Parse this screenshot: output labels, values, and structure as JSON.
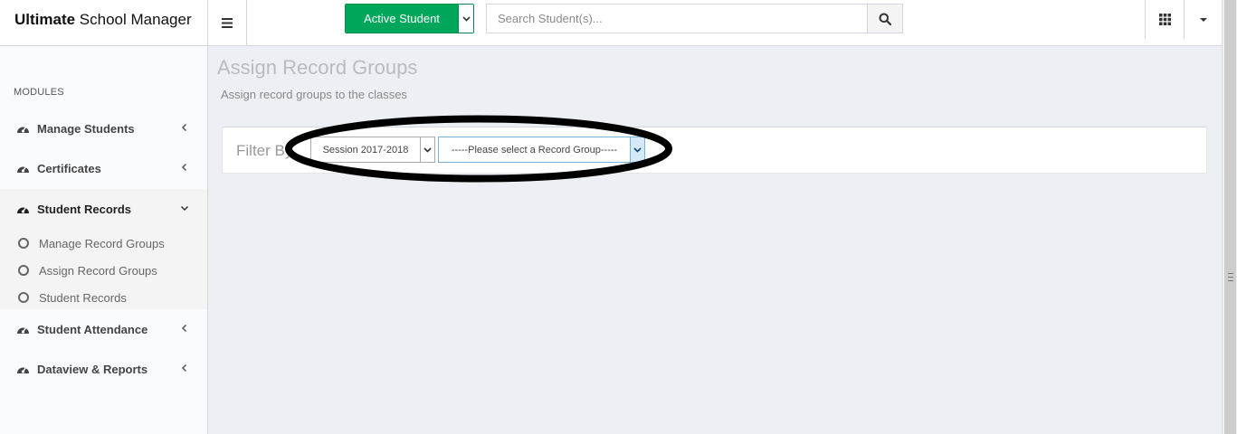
{
  "brand": {
    "bold": "Ultimate",
    "rest": " School Manager"
  },
  "header": {
    "active_student_label": "Active Student",
    "search_placeholder": "Search Student(s)..."
  },
  "sidebar": {
    "modules_label": "MODULES",
    "items": [
      {
        "label": "Manage Students"
      },
      {
        "label": "Certificates"
      },
      {
        "label": "Student Records"
      },
      {
        "label": "Student Attendance"
      },
      {
        "label": "Dataview & Reports"
      }
    ],
    "submenu": [
      {
        "label": "Manage Record Groups"
      },
      {
        "label": "Assign Record Groups"
      },
      {
        "label": "Student Records"
      }
    ]
  },
  "page": {
    "title": "Assign Record Groups",
    "subtitle": "Assign record groups to the classes"
  },
  "filter": {
    "label": "Filter By",
    "session_value": "Session 2017-2018",
    "record_group_value": "-----Please select a Record Group-----"
  },
  "colors": {
    "accent_green": "#00a65a",
    "annotation": "#000000"
  }
}
